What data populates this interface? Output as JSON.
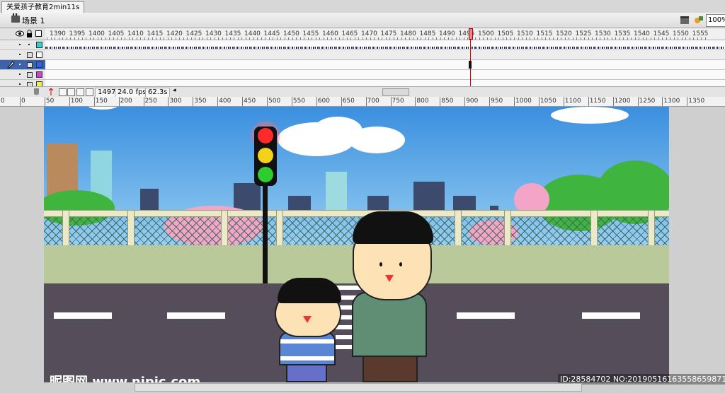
{
  "document": {
    "tab_title": "关爱孩子教育2min11s"
  },
  "edit_bar": {
    "scene_label": "场景 1",
    "zoom": "100%"
  },
  "timeline": {
    "frame_labels": [
      "1390",
      "1395",
      "1400",
      "1405",
      "1410",
      "1415",
      "1420",
      "1425",
      "1430",
      "1435",
      "1440",
      "1445",
      "1450",
      "1455",
      "1460",
      "1465",
      "1470",
      "1475",
      "1480",
      "1485",
      "1490",
      "1495",
      "1500",
      "1505",
      "1510",
      "1515",
      "1520",
      "1525",
      "1530",
      "1535",
      "1540",
      "1545",
      "1550",
      "1555"
    ],
    "current_frame": "1497",
    "fps": "24.0 fps",
    "elapsed": "62.3s",
    "layer_colors": [
      "#30d0d0",
      "#ffffff",
      "#3060f0",
      "#d040d0",
      "#f0f040"
    ]
  },
  "stage_ruler": {
    "labels": [
      "50",
      "0",
      "50",
      "100",
      "150",
      "200",
      "250",
      "300",
      "350",
      "400",
      "450",
      "500",
      "550",
      "600",
      "650",
      "700",
      "750",
      "800",
      "850",
      "900",
      "950",
      "1000",
      "1050",
      "1100",
      "1150",
      "1200",
      "1250",
      "1300",
      "1350"
    ]
  },
  "scene": {
    "traffic_light": {
      "red": "#ff2a2a",
      "yellow": "#f2d21a",
      "green": "#2ecc2e",
      "active": "red"
    },
    "colors": {
      "sky": "#3a8fdf",
      "road": "#564d5a",
      "grass": "#b9c99a"
    }
  },
  "watermarks": {
    "left": "昵图网 www.nipic.com",
    "right": "ID:28584702 NO:20190516163558659871"
  }
}
